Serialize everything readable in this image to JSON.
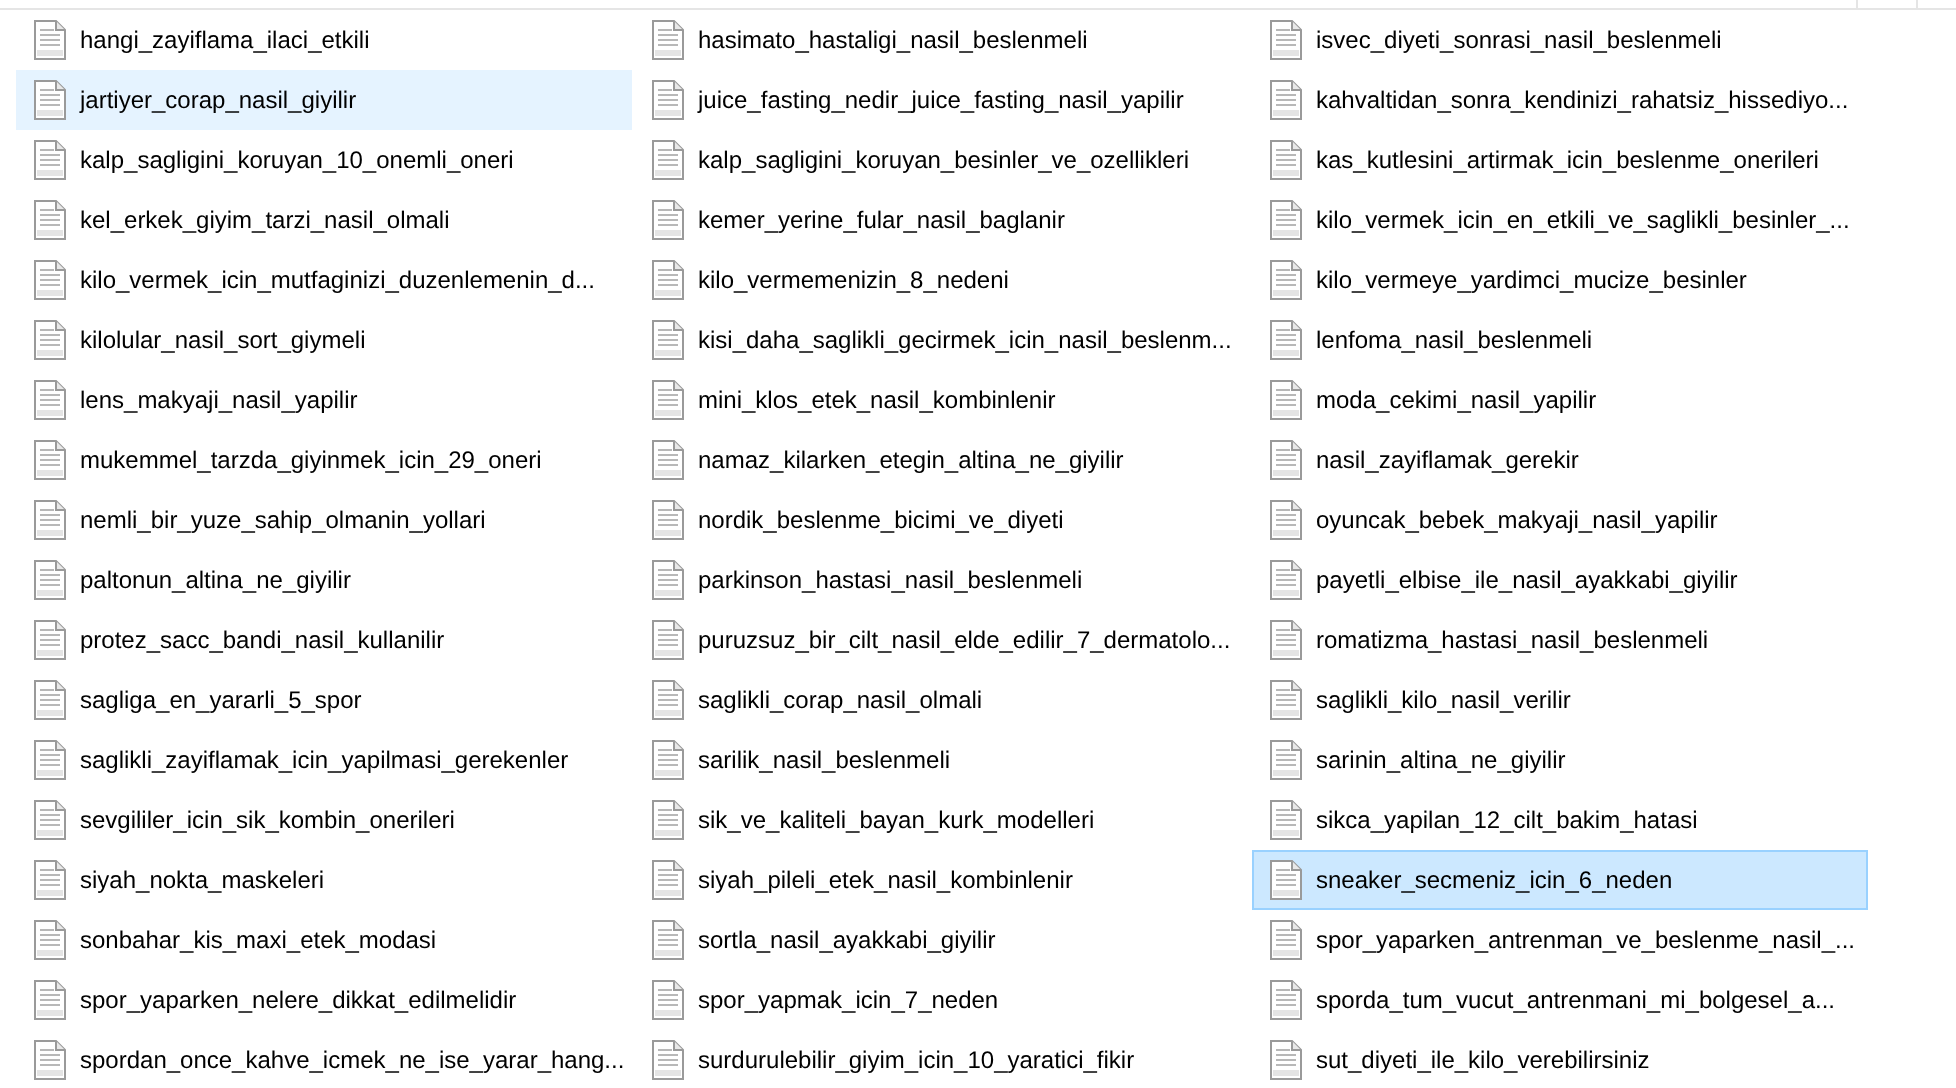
{
  "columns": [
    {
      "items": [
        {
          "name": "hangi_zayiflama_ilaci_etkili",
          "selected": false,
          "hovered": false
        },
        {
          "name": "jartiyer_corap_nasil_giyilir",
          "selected": false,
          "hovered": true
        },
        {
          "name": "kalp_sagligini_koruyan_10_onemli_oneri",
          "selected": false,
          "hovered": false
        },
        {
          "name": "kel_erkek_giyim_tarzi_nasil_olmali",
          "selected": false,
          "hovered": false
        },
        {
          "name": "kilo_vermek_icin_mutfaginizi_duzenlemenin_d...",
          "selected": false,
          "hovered": false
        },
        {
          "name": "kilolular_nasil_sort_giymeli",
          "selected": false,
          "hovered": false
        },
        {
          "name": "lens_makyaji_nasil_yapilir",
          "selected": false,
          "hovered": false
        },
        {
          "name": "mukemmel_tarzda_giyinmek_icin_29_oneri",
          "selected": false,
          "hovered": false
        },
        {
          "name": "nemli_bir_yuze_sahip_olmanin_yollari",
          "selected": false,
          "hovered": false
        },
        {
          "name": "paltonun_altina_ne_giyilir",
          "selected": false,
          "hovered": false
        },
        {
          "name": "protez_sacc_bandi_nasil_kullanilir",
          "selected": false,
          "hovered": false
        },
        {
          "name": "sagliga_en_yararli_5_spor",
          "selected": false,
          "hovered": false
        },
        {
          "name": "saglikli_zayiflamak_icin_yapilmasi_gerekenler",
          "selected": false,
          "hovered": false
        },
        {
          "name": "sevgililer_icin_sik_kombin_onerileri",
          "selected": false,
          "hovered": false
        },
        {
          "name": "siyah_nokta_maskeleri",
          "selected": false,
          "hovered": false
        },
        {
          "name": "sonbahar_kis_maxi_etek_modasi",
          "selected": false,
          "hovered": false
        },
        {
          "name": "spor_yaparken_nelere_dikkat_edilmelidir",
          "selected": false,
          "hovered": false
        },
        {
          "name": "spordan_once_kahve_icmek_ne_ise_yarar_hang...",
          "selected": false,
          "hovered": false
        }
      ]
    },
    {
      "items": [
        {
          "name": "hasimato_hastaligi_nasil_beslenmeli",
          "selected": false,
          "hovered": false
        },
        {
          "name": "juice_fasting_nedir_juice_fasting_nasil_yapilir",
          "selected": false,
          "hovered": false
        },
        {
          "name": "kalp_sagligini_koruyan_besinler_ve_ozellikleri",
          "selected": false,
          "hovered": false
        },
        {
          "name": "kemer_yerine_fular_nasil_baglanir",
          "selected": false,
          "hovered": false
        },
        {
          "name": "kilo_vermemenizin_8_nedeni",
          "selected": false,
          "hovered": false
        },
        {
          "name": "kisi_daha_saglikli_gecirmek_icin_nasil_beslenm...",
          "selected": false,
          "hovered": false
        },
        {
          "name": "mini_klos_etek_nasil_kombinlenir",
          "selected": false,
          "hovered": false
        },
        {
          "name": "namaz_kilarken_etegin_altina_ne_giyilir",
          "selected": false,
          "hovered": false
        },
        {
          "name": "nordik_beslenme_bicimi_ve_diyeti",
          "selected": false,
          "hovered": false
        },
        {
          "name": "parkinson_hastasi_nasil_beslenmeli",
          "selected": false,
          "hovered": false
        },
        {
          "name": "puruzsuz_bir_cilt_nasil_elde_edilir_7_dermatolo...",
          "selected": false,
          "hovered": false
        },
        {
          "name": "saglikli_corap_nasil_olmali",
          "selected": false,
          "hovered": false
        },
        {
          "name": "sarilik_nasil_beslenmeli",
          "selected": false,
          "hovered": false
        },
        {
          "name": "sik_ve_kaliteli_bayan_kurk_modelleri",
          "selected": false,
          "hovered": false
        },
        {
          "name": "siyah_pileli_etek_nasil_kombinlenir",
          "selected": false,
          "hovered": false
        },
        {
          "name": "sortla_nasil_ayakkabi_giyilir",
          "selected": false,
          "hovered": false
        },
        {
          "name": "spor_yapmak_icin_7_neden",
          "selected": false,
          "hovered": false
        },
        {
          "name": "surdurulebilir_giyim_icin_10_yaratici_fikir",
          "selected": false,
          "hovered": false
        }
      ]
    },
    {
      "items": [
        {
          "name": "isvec_diyeti_sonrasi_nasil_beslenmeli",
          "selected": false,
          "hovered": false
        },
        {
          "name": "kahvaltidan_sonra_kendinizi_rahatsiz_hissediyo...",
          "selected": false,
          "hovered": false
        },
        {
          "name": "kas_kutlesini_artirmak_icin_beslenme_onerileri",
          "selected": false,
          "hovered": false
        },
        {
          "name": "kilo_vermek_icin_en_etkili_ve_saglikli_besinler_...",
          "selected": false,
          "hovered": false
        },
        {
          "name": "kilo_vermeye_yardimci_mucize_besinler",
          "selected": false,
          "hovered": false
        },
        {
          "name": "lenfoma_nasil_beslenmeli",
          "selected": false,
          "hovered": false
        },
        {
          "name": "moda_cekimi_nasil_yapilir",
          "selected": false,
          "hovered": false
        },
        {
          "name": "nasil_zayiflamak_gerekir",
          "selected": false,
          "hovered": false
        },
        {
          "name": "oyuncak_bebek_makyaji_nasil_yapilir",
          "selected": false,
          "hovered": false
        },
        {
          "name": "payetli_elbise_ile_nasil_ayakkabi_giyilir",
          "selected": false,
          "hovered": false
        },
        {
          "name": "romatizma_hastasi_nasil_beslenmeli",
          "selected": false,
          "hovered": false
        },
        {
          "name": "saglikli_kilo_nasil_verilir",
          "selected": false,
          "hovered": false
        },
        {
          "name": "sarinin_altina_ne_giyilir",
          "selected": false,
          "hovered": false
        },
        {
          "name": "sikca_yapilan_12_cilt_bakim_hatasi",
          "selected": false,
          "hovered": false
        },
        {
          "name": "sneaker_secmeniz_icin_6_neden",
          "selected": true,
          "hovered": false
        },
        {
          "name": "spor_yaparken_antrenman_ve_beslenme_nasil_...",
          "selected": false,
          "hovered": false
        },
        {
          "name": "sporda_tum_vucut_antrenmani_mi_bolgesel_a...",
          "selected": false,
          "hovered": false
        },
        {
          "name": "sut_diyeti_ile_kilo_verebilirsiniz",
          "selected": false,
          "hovered": false
        }
      ]
    }
  ]
}
